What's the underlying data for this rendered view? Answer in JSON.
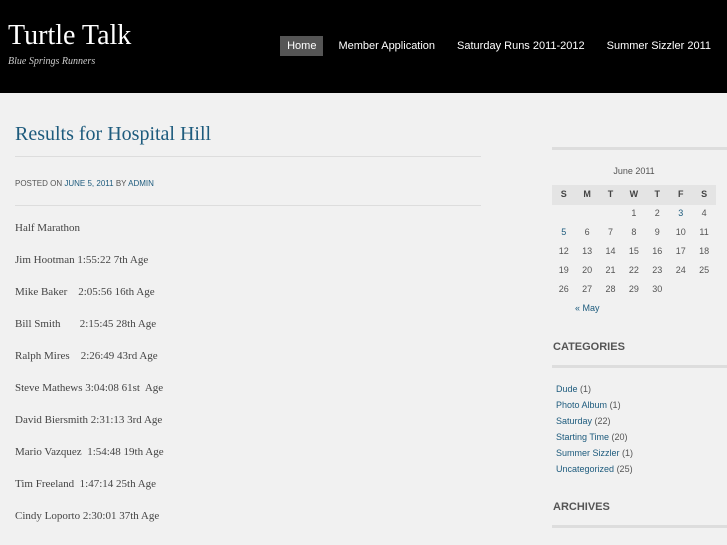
{
  "site": {
    "title": "Turtle Talk",
    "description": "Blue Springs Runners"
  },
  "nav": {
    "items": [
      "Home",
      "Member Application",
      "Saturday Runs 2011-2012",
      "Summer Sizzler 2011"
    ]
  },
  "post": {
    "title": "Results for Hospital Hill",
    "meta_prefix": "Posted on",
    "meta_date": "June 5, 2011",
    "meta_by": "by",
    "meta_author": "admin",
    "lines": [
      "Half Marathon",
      "Jim Hootman 1:55:22 7th Age",
      "Mike Baker    2:05:56 16th Age",
      "Bill Smith       2:15:45 28th Age",
      "Ralph Mires    2:26:49 43rd Age",
      "Steve Mathews 3:04:08 61st  Age",
      "David Biersmith 2:31:13 3rd Age",
      "Mario Vazquez  1:54:48 19th Age",
      "Tim Freeland  1:47:14 25th Age",
      "Cindy Loporto 2:30:01 37th Age"
    ]
  },
  "calendar": {
    "caption": "June 2011",
    "days": [
      "S",
      "M",
      "T",
      "W",
      "T",
      "F",
      "S"
    ],
    "weeks": [
      [
        "",
        "",
        "",
        "1",
        "2",
        "3",
        "4"
      ],
      [
        "5",
        "6",
        "7",
        "8",
        "9",
        "10",
        "11"
      ],
      [
        "12",
        "13",
        "14",
        "15",
        "16",
        "17",
        "18"
      ],
      [
        "19",
        "20",
        "21",
        "22",
        "23",
        "24",
        "25"
      ],
      [
        "26",
        "27",
        "28",
        "29",
        "30",
        "",
        ""
      ]
    ],
    "linked_days": [
      "3",
      "5"
    ],
    "prev": "« May"
  },
  "categories": {
    "title": "Categories",
    "items": [
      {
        "name": "Dude",
        "count": "(1)"
      },
      {
        "name": "Photo Album",
        "count": "(1)"
      },
      {
        "name": "Saturday",
        "count": "(22)"
      },
      {
        "name": "Starting Time",
        "count": "(20)"
      },
      {
        "name": "Summer Sizzler",
        "count": "(1)"
      },
      {
        "name": "Uncategorized",
        "count": "(25)"
      }
    ]
  },
  "archives": {
    "title": "Archives"
  },
  "colors": {
    "header_bg": "#000000",
    "link": "#1d5b7d",
    "nav_active": "#555555",
    "page_bg": "#f1f1f1"
  }
}
